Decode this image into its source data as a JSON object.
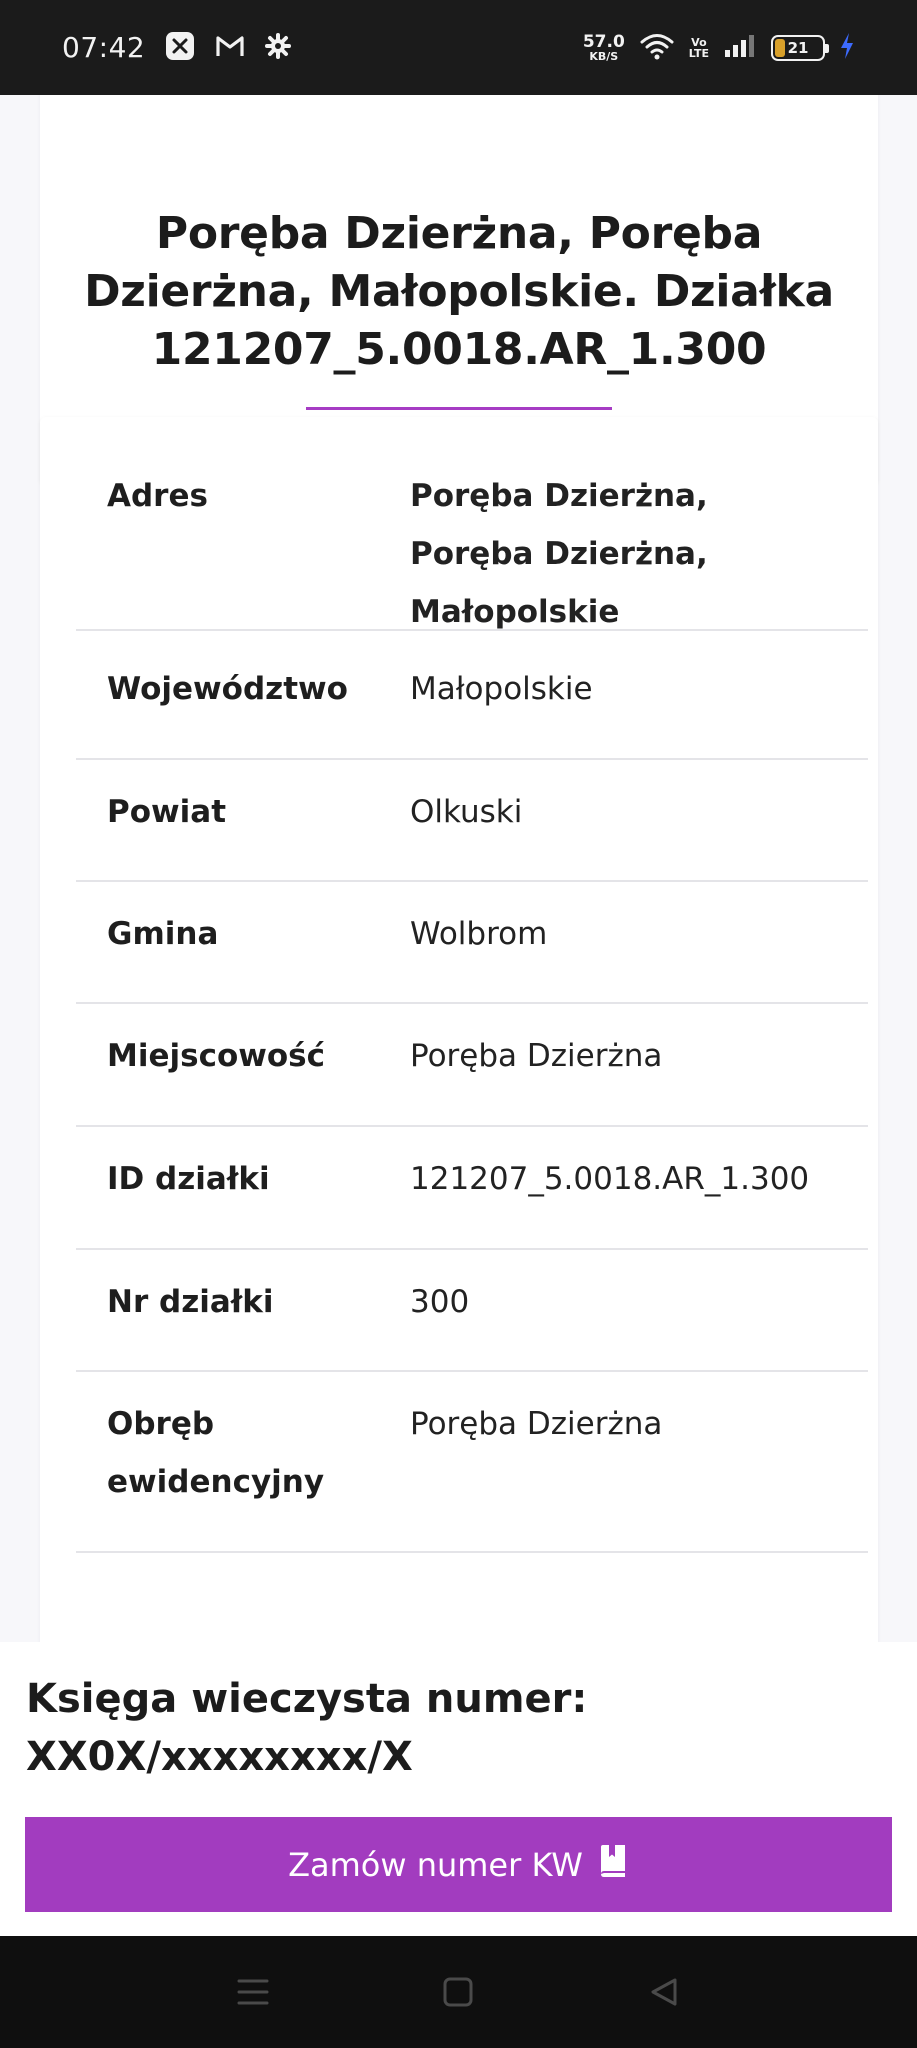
{
  "status_bar": {
    "time": "07:42",
    "net_speed": "57.0",
    "net_unit": "KB/S",
    "volte_top": "Vo",
    "volte_bottom": "LTE",
    "battery_level": "21",
    "battery_fill_percent": 21,
    "battery_fill_color": "#d8a02a",
    "charging_color": "#3d6bff"
  },
  "header": {
    "title": "Poręba Dzierżna, Poręba Dzierżna, Małopolskie. Działka 121207_5.0018.AR_1.300",
    "accent_color": "#a63cc4"
  },
  "details": {
    "rows": [
      {
        "label": "Adres",
        "value": "Poręba Dzierżna, Poręba Dzierżna, Małopolskie"
      },
      {
        "label": "Województwo",
        "value": "Małopolskie"
      },
      {
        "label": "Powiat",
        "value": "Olkuski"
      },
      {
        "label": "Gmina",
        "value": "Wolbrom"
      },
      {
        "label": "Miejscowość",
        "value": "Poręba Dzierżna"
      },
      {
        "label": "ID działki",
        "value": "121207_5.0018.AR_1.300"
      },
      {
        "label": "Nr działki",
        "value": "300"
      },
      {
        "label": "Obręb ewidencyjny",
        "value": "Poręba Dzierżna"
      }
    ]
  },
  "kw": {
    "title": "Księga wieczysta numer: XX0X/xxxxxxxx/X",
    "button_label": "Zamów numer KW",
    "button_icon": "book-icon",
    "button_color": "#a23cbf"
  },
  "nav": {
    "menu_icon": "menu-icon",
    "home_icon": "home-square-icon",
    "back_icon": "back-triangle-icon"
  }
}
